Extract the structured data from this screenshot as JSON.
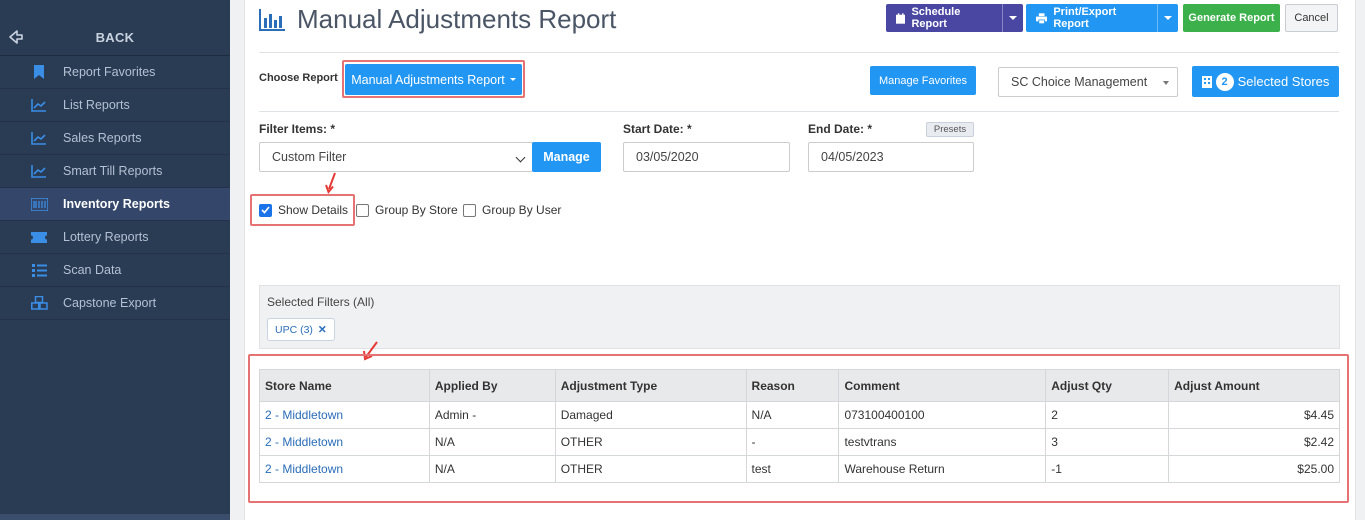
{
  "sidebar": {
    "back_label": "BACK",
    "items": [
      {
        "label": "Report Favorites",
        "icon": "bookmark-icon",
        "active": false
      },
      {
        "label": "List Reports",
        "icon": "line-chart-icon",
        "active": false
      },
      {
        "label": "Sales Reports",
        "icon": "line-chart-icon",
        "active": false
      },
      {
        "label": "Smart Till Reports",
        "icon": "line-chart-icon",
        "active": false
      },
      {
        "label": "Inventory Reports",
        "icon": "barcode-icon",
        "active": true
      },
      {
        "label": "Lottery Reports",
        "icon": "ticket-icon",
        "active": false
      },
      {
        "label": "Scan Data",
        "icon": "list-icon",
        "active": false
      },
      {
        "label": "Capstone Export",
        "icon": "cubes-icon",
        "active": false
      }
    ]
  },
  "header": {
    "title": "Manual Adjustments Report",
    "schedule_label": "Schedule Report",
    "print_label": "Print/Export Report",
    "generate_label": "Generate Report",
    "cancel_label": "Cancel"
  },
  "choose": {
    "label": "Choose Report",
    "report_dropdown": "Manual Adjustments Report",
    "manage_favorites": "Manage Favorites",
    "company_select": "SC Choice Management",
    "stores_count": "2",
    "stores_label": "Selected Stores"
  },
  "filters": {
    "filter_items_label": "Filter Items: *",
    "filter_value": "Custom Filter",
    "manage_label": "Manage",
    "start_label": "Start Date: *",
    "start_value": "03/05/2020",
    "end_label": "End Date: *",
    "end_value": "04/05/2023",
    "presets_label": "Presets"
  },
  "options": {
    "show_details": "Show Details",
    "show_details_checked": true,
    "group_by_store": "Group By Store",
    "group_by_user": "Group By User"
  },
  "selected_filters": {
    "title": "Selected Filters (All)",
    "chip": "UPC (3)",
    "chip_close": "✕"
  },
  "table": {
    "headers": [
      "Store Name",
      "Applied By",
      "Adjustment Type",
      "Reason",
      "Comment",
      "Adjust Qty",
      "Adjust Amount"
    ],
    "rows": [
      [
        "2 - Middletown",
        "Admin -",
        "Damaged",
        "N/A",
        "073100400100",
        "2",
        "$4.45"
      ],
      [
        "2 - Middletown",
        "N/A",
        "OTHER",
        "-",
        "testvtrans",
        "3",
        "$2.42"
      ],
      [
        "2 - Middletown",
        "N/A",
        "OTHER",
        "test",
        "Warehouse Return",
        "-1",
        "$25.00"
      ]
    ]
  },
  "colors": {
    "sidebar_bg": "#2a3b54",
    "primary": "#2196f3",
    "purple": "#4a47a3",
    "green": "#3cb04a",
    "highlight": "#e57373"
  }
}
